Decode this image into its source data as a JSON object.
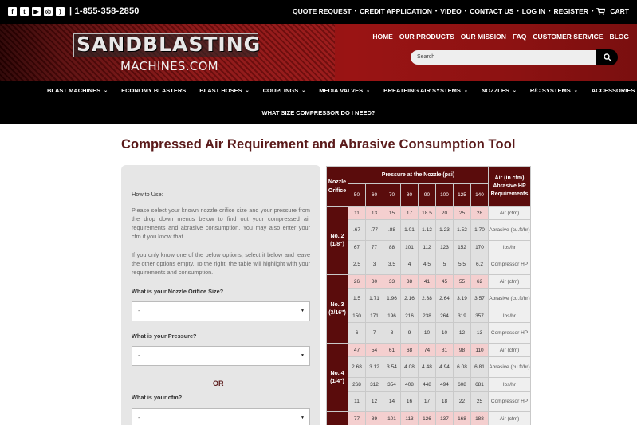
{
  "topbar": {
    "social_icons": [
      "facebook-icon",
      "twitter-icon",
      "youtube-icon",
      "instagram-icon",
      "rss-icon"
    ],
    "phone": "| 1-855-358-2850",
    "links": [
      "QUOTE REQUEST",
      "CREDIT APPLICATION",
      "VIDEO",
      "CONTACT US",
      "LOG IN",
      "REGISTER",
      "CART"
    ]
  },
  "header": {
    "logo_main": "SANDBLASTING",
    "logo_sub": "MACHINES.COM",
    "nav": [
      "HOME",
      "OUR PRODUCTS",
      "OUR MISSION",
      "FAQ",
      "CUSTOMER SERVICE",
      "BLOG"
    ],
    "search_placeholder": "Search"
  },
  "catnav": {
    "items": [
      {
        "label": "BLAST MACHINES",
        "dropdown": true
      },
      {
        "label": "ECONOMY BLASTERS",
        "dropdown": false
      },
      {
        "label": "BLAST HOSES",
        "dropdown": true
      },
      {
        "label": "COUPLINGS",
        "dropdown": true
      },
      {
        "label": "MEDIA VALVES",
        "dropdown": true
      },
      {
        "label": "BREATHING AIR SYSTEMS",
        "dropdown": true
      },
      {
        "label": "NOZZLES",
        "dropdown": true
      },
      {
        "label": "R/C SYSTEMS",
        "dropdown": true
      },
      {
        "label": "ACCESSORIES",
        "dropdown": true
      }
    ],
    "second_row": "WHAT SIZE COMPRESSOR DO I NEED?"
  },
  "page_title": "Compressed Air Requirement and Abrasive Consumption Tool",
  "panel": {
    "how_to": "How to Use:",
    "para1": "Please select your known nozzle orifice size and your pressure from the drop down menus below to find out your compressed air requirements and abrasive consumption. You may also enter your cfm if you know that.",
    "para2": "If you only know one of the below options, select it below and leave the other options empty. To the right, the table will highlight with your requirements and consumption.",
    "q_nozzle": "What is your Nozzle Orifice Size?",
    "q_pressure": "What is your Pressure?",
    "or_text": "OR",
    "q_cfm": "What is your cfm?",
    "select_default": "-"
  },
  "table": {
    "nozzle_header": "Nozzle Orifice",
    "pressure_header": "Pressure at the Nozzle (psi)",
    "req_header": "Air (in cfm) Abrasive HP Requirements",
    "pressures": [
      "50",
      "60",
      "70",
      "80",
      "90",
      "100",
      "125",
      "140"
    ],
    "groups": [
      {
        "nozzle": "No. 2 (1/8\")",
        "rows": [
          {
            "vals": [
              "11",
              "13",
              "15",
              "17",
              "18.5",
              "20",
              "25",
              "28"
            ],
            "req": "Air (cfm)"
          },
          {
            "vals": [
              ".67",
              ".77",
              ".88",
              "1.01",
              "1.12",
              "1.23",
              "1.52",
              "1.70"
            ],
            "req": "Abrasive (cu.ft/hr)"
          },
          {
            "vals": [
              "67",
              "77",
              "88",
              "101",
              "112",
              "123",
              "152",
              "170"
            ],
            "req": "lbs/hr"
          },
          {
            "vals": [
              "2.5",
              "3",
              "3.5",
              "4",
              "4.5",
              "5",
              "5.5",
              "6.2"
            ],
            "req": "Compressor HP"
          }
        ]
      },
      {
        "nozzle": "No. 3 (3/16\")",
        "rows": [
          {
            "vals": [
              "26",
              "30",
              "33",
              "38",
              "41",
              "45",
              "55",
              "62"
            ],
            "req": "Air (cfm)"
          },
          {
            "vals": [
              "1.5",
              "1.71",
              "1.96",
              "2.16",
              "2.38",
              "2.64",
              "3.19",
              "3.57"
            ],
            "req": "Abrasive (cu.ft/hr)"
          },
          {
            "vals": [
              "150",
              "171",
              "196",
              "216",
              "238",
              "264",
              "319",
              "357"
            ],
            "req": "lbs/hr"
          },
          {
            "vals": [
              "6",
              "7",
              "8",
              "9",
              "10",
              "10",
              "12",
              "13"
            ],
            "req": "Compressor HP"
          }
        ]
      },
      {
        "nozzle": "No. 4 (1/4\")",
        "rows": [
          {
            "vals": [
              "47",
              "54",
              "61",
              "68",
              "74",
              "81",
              "98",
              "110"
            ],
            "req": "Air (cfm)"
          },
          {
            "vals": [
              "2.68",
              "3.12",
              "3.54",
              "4.08",
              "4.48",
              "4.94",
              "6.08",
              "6.81"
            ],
            "req": "Abrasive (cu.ft/hr)"
          },
          {
            "vals": [
              "268",
              "312",
              "354",
              "408",
              "448",
              "494",
              "608",
              "681"
            ],
            "req": "lbs/hr"
          },
          {
            "vals": [
              "11",
              "12",
              "14",
              "16",
              "17",
              "18",
              "22",
              "25"
            ],
            "req": "Compressor HP"
          }
        ]
      },
      {
        "nozzle": "",
        "rows": [
          {
            "vals": [
              "77",
              "89",
              "101",
              "113",
              "126",
              "137",
              "168",
              "188"
            ],
            "req": "Air (cfm)"
          }
        ]
      }
    ]
  }
}
